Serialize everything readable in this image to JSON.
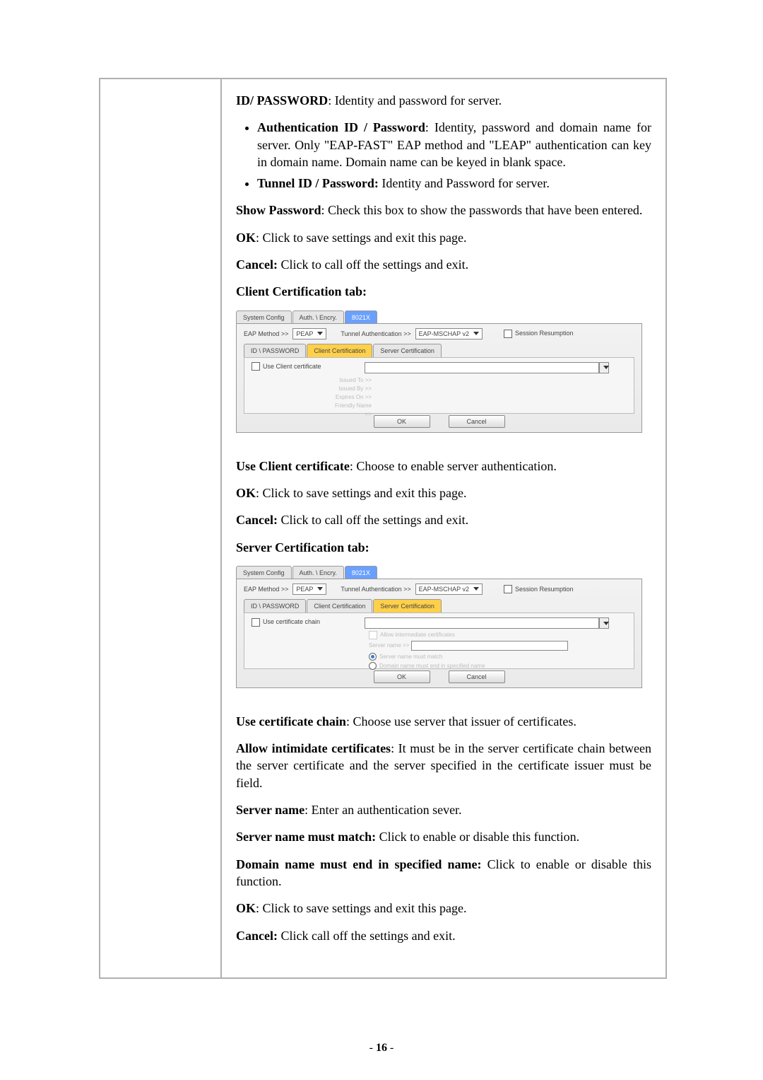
{
  "pagenum_prefix": "- ",
  "pagenum": "16",
  "pagenum_suffix": " -",
  "doc": {
    "idpw_h": "ID/ PASSWORD",
    "idpw_t": ": Identity and password for server.",
    "auth_h": "Authentication ID / Password",
    "auth_t": ": Identity, password and domain name for server. Only \"EAP-FAST\" EAP method and \"LEAP\" authentication can key in domain name. Domain name can be keyed in blank space.",
    "tunnel_h": "Tunnel ID / Password:",
    "tunnel_t": " Identity and Password for server.",
    "showpw_h": "Show Password",
    "showpw_t": ": Check this box to show the passwords that have been entered.",
    "ok_h": "OK",
    "ok_t": ": Click to save settings and exit this page.",
    "cancel_h": "Cancel:",
    "cancel_t": " Click to call off the settings and exit.",
    "clienttab_h": "Client Certification tab:",
    "usecert_h": "Use Client certificate",
    "usecert_t": ": Choose to enable server authentication.",
    "servertab_h": "Server Certification tab:",
    "usechain_h": "Use certificate chain",
    "usechain_t": ": Choose use server that issuer of certificates.",
    "allow_h": "Allow intimidate certificates",
    "allow_t": ": It must be in the server certificate chain between the server certificate and the server specified in the certificate issuer must be field.",
    "srvname_h": "Server name",
    "srvname_t": ": Enter an authentication sever.",
    "match_h": "Server name must match:",
    "match_t": " Click to enable or disable this function.",
    "domain_h": "Domain name must end in specified name:",
    "domain_t": " Click to enable or disable this function.",
    "cancel2_t": " Click call off the settings and exit."
  },
  "ui": {
    "tab_sys": "System Config",
    "tab_auth": "Auth. \\ Encry.",
    "tab_8021x": "8021X",
    "eap_lbl": "EAP Method >>",
    "eap_val": "PEAP",
    "tauth_lbl": "Tunnel Authentication >>",
    "tauth_val": "EAP-MSCHAP v2",
    "session": "Session Resumption",
    "sub_idpw": "ID \\ PASSWORD",
    "sub_client": "Client Certification",
    "sub_server": "Server Certification",
    "use_client": "Use Client certificate",
    "issued_to": "Issued To >>",
    "issued_by": "Issued By >>",
    "expires": "Expires On >>",
    "friendly": "Friendly Name >>",
    "ok": "OK",
    "cancel": "Cancel",
    "use_chain": "Use certificate chain",
    "allow_inter": "Allow intermediate certificates",
    "server_name": "Server name >>",
    "r_match": "Server name must match",
    "r_domain": "Domain name must end in specified name"
  }
}
